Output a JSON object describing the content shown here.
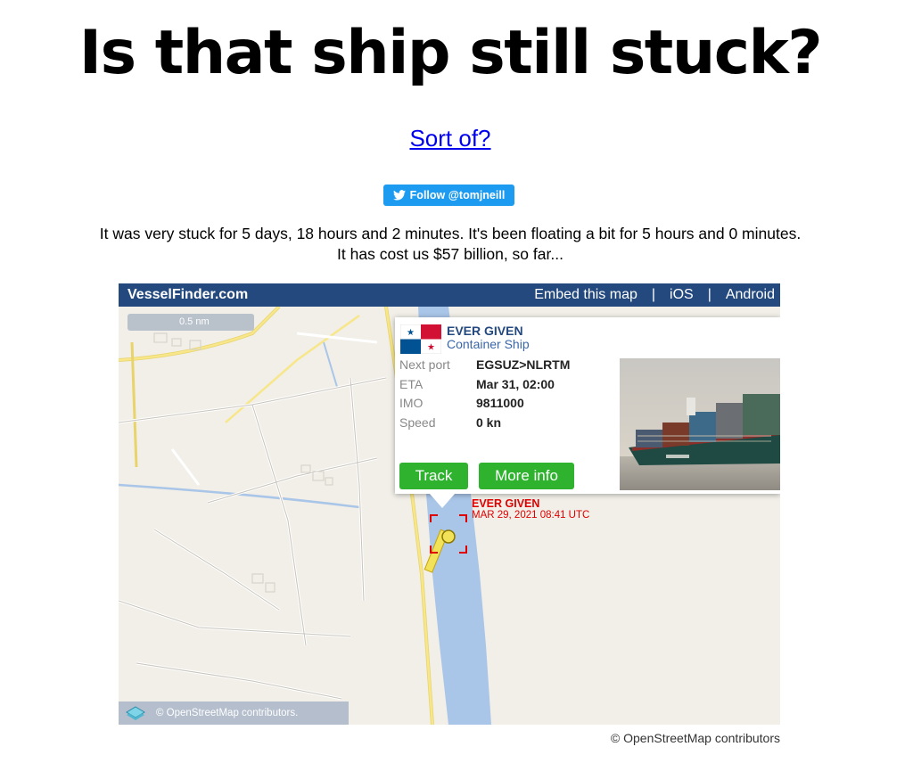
{
  "page": {
    "headline": "Is that ship still stuck?",
    "sort_of_link": "Sort of?",
    "follow_button": "Follow @tomjneill",
    "status_line_1": "It was very stuck for 5 days, 18 hours and 2 minutes. It's been floating a bit for 5 hours and 0 minutes.",
    "status_line_2": "It has cost us $57 billion, so far...",
    "attribution": "© OpenStreetMap contributors"
  },
  "map": {
    "brand": "VesselFinder.com",
    "links": [
      "Embed this map",
      "iOS",
      "Android"
    ],
    "link_separator": "|",
    "scale_label": "0.5 nm",
    "attribution": "© OpenStreetMap contributors.",
    "colors": {
      "bar": "#24497e",
      "water": "#a9c5e8",
      "road": "#f7e68a",
      "button": "#2fb32f",
      "marker": "#e00000"
    },
    "popup": {
      "name": "EVER GIVEN",
      "type": "Container Ship",
      "flag_icon": "panama-flag-icon",
      "fields": [
        {
          "label": "Next port",
          "value": "EGSUZ>NLRTM"
        },
        {
          "label": "ETA",
          "value": "Mar 31, 02:00"
        },
        {
          "label": "IMO",
          "value": "9811000"
        },
        {
          "label": "Speed",
          "value": "0 kn"
        }
      ],
      "track_button": "Track",
      "more_info_button": "More info"
    },
    "marker": {
      "name": "EVER GIVEN",
      "timestamp": "MAR 29, 2021 08:41 UTC"
    }
  }
}
